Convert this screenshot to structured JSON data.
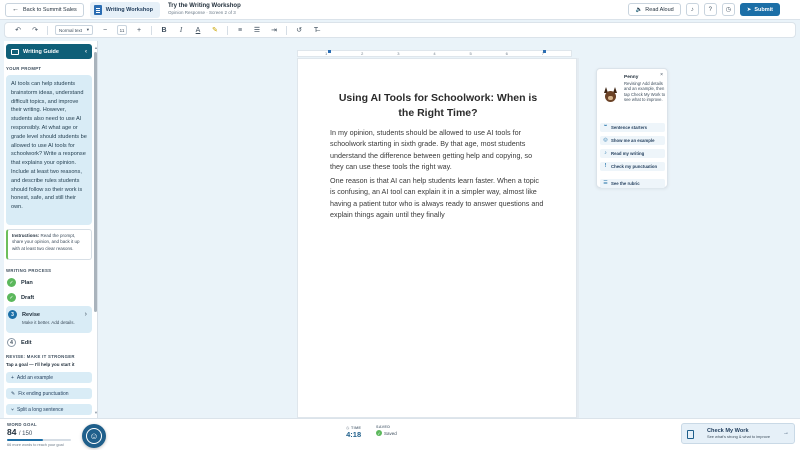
{
  "topbar": {
    "back_label": "Back to Summit Sales",
    "tab_label": "Writing Workshop",
    "title": "Try the Writing Workshop",
    "subtitle": "Opinion Response · Screen 2 of 3",
    "read_aloud_label": "Read Aloud",
    "submit_label": "Submit"
  },
  "toolbar": {
    "style_value": "Normal text",
    "font_size": "11"
  },
  "sidebar": {
    "header": "Writing Guide",
    "prompt_label": "YOUR PROMPT",
    "prompt_text": "AI tools can help students brainstorm ideas, understand difficult topics, and improve their writing. However, students also need to use AI responsibly. At what age or grade level should students be allowed to use AI tools for schoolwork? Write a response that explains your opinion. Include at least two reasons, and describe rules students should follow so their work is honest, safe, and still their own.",
    "instructions_label": "Instructions:",
    "instructions_text": "Read the prompt, share your opinion, and back it up with at least two clear reasons.",
    "process_label": "WRITING PROCESS",
    "steps": [
      {
        "label": "Plan",
        "status": "done",
        "marker": "✓"
      },
      {
        "label": "Draft",
        "status": "done",
        "marker": "✓"
      },
      {
        "label": "Revise",
        "status": "current",
        "marker": "3",
        "sub": "Make it better. Add details."
      },
      {
        "label": "Edit",
        "status": "todo",
        "marker": "4"
      }
    ],
    "revise_label": "REVISE: MAKE IT STRONGER",
    "revise_sub": "Tap a goal — I'll help you start it",
    "goals": [
      "Add an example",
      "Fix ending punctuation",
      "Split a long sentence"
    ]
  },
  "document": {
    "title": "Using AI Tools for Schoolwork: When is the Right Time?",
    "paragraphs": [
      "In my opinion, students should be allowed to use AI tools for schoolwork starting in sixth grade. By that age, most students understand the difference between getting help and copying, so they can use these tools the right way.",
      "One reason is that AI can help students learn faster. When a topic is confusing, an AI tool can explain it in a simpler way, almost like having a patient tutor who is always ready to answer questions and explain things again until they finally"
    ],
    "ruler_numbers": [
      "1",
      "2",
      "3",
      "4",
      "5",
      "6",
      "7"
    ]
  },
  "assistant": {
    "name": "Penny",
    "message": "Revising! Add details and an example, then tap Check My Work to see what to improve.",
    "options": [
      "Sentence starters",
      "Show me an example",
      "Read my writing",
      "Check my punctuation",
      "See the rubric"
    ]
  },
  "footer": {
    "word_goal_label": "WORD GOAL",
    "word_count": "84",
    "word_total": "/ 150",
    "word_progress": 0.56,
    "word_msg": "66 more words to reach your goal",
    "time_label": "TIME",
    "time_value": "4:18",
    "saved_label": "SAVED",
    "saved_value": "Saved",
    "check_title": "Check My Work",
    "check_sub": "See what's strong & what to improve"
  },
  "colors": {
    "accent": "#1c6fa7",
    "sidebar_header": "#0f5f78",
    "done": "#5cb85c",
    "light_panel": "#d9ecf6"
  }
}
